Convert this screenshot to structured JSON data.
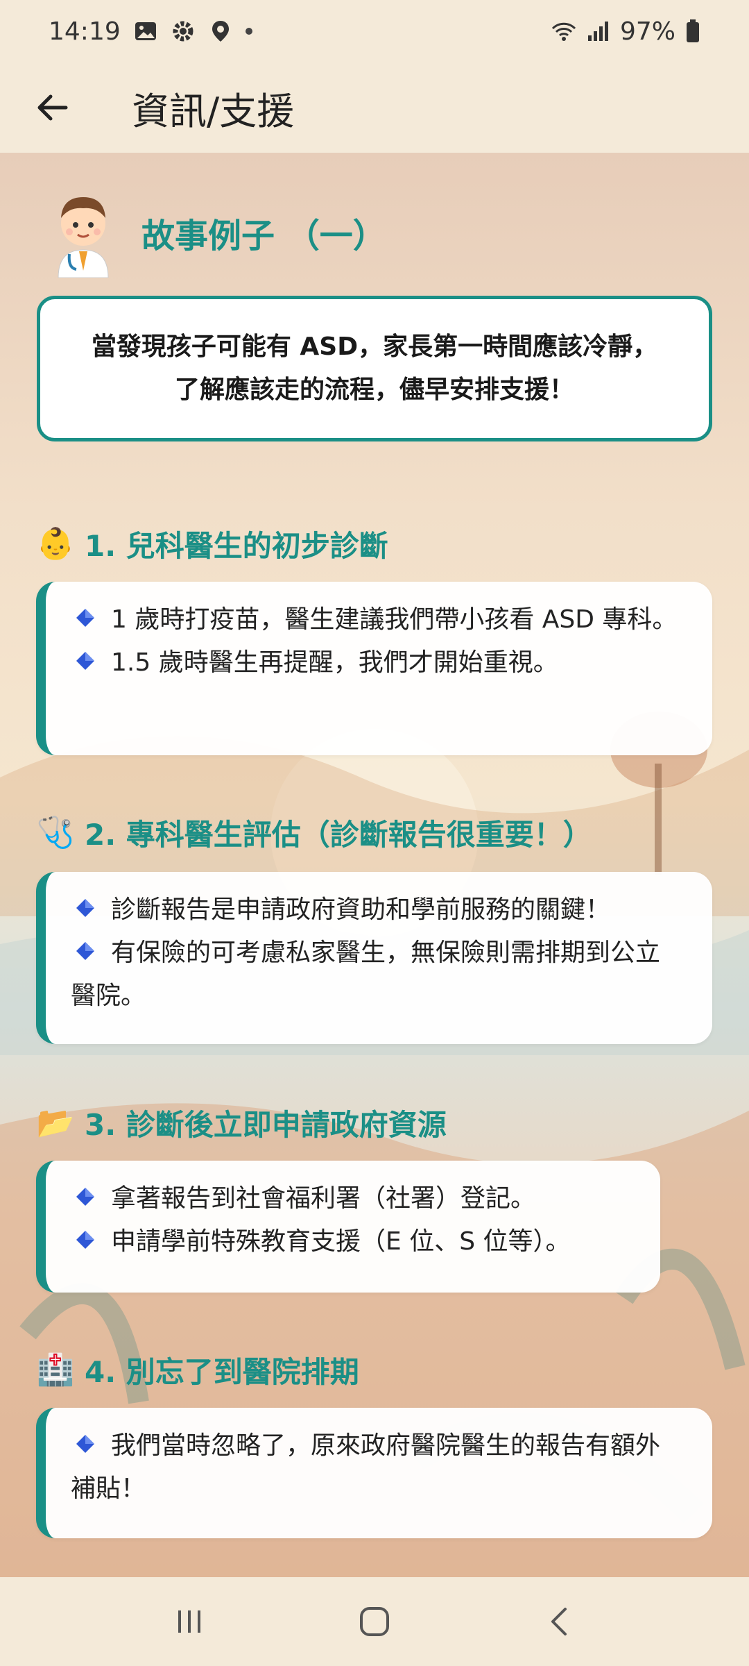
{
  "status_bar": {
    "time": "14:19",
    "battery": "97%",
    "icons_left": [
      "image-icon",
      "gear-icon",
      "location-icon",
      "dot-icon"
    ],
    "icons_right": [
      "wifi-icon",
      "signal-icon",
      "battery-icon"
    ]
  },
  "app_bar": {
    "title": "資訊/支援",
    "back_icon": "arrow-left-icon"
  },
  "story": {
    "title": "故事例子 （一）",
    "avatar": "doctor-avatar",
    "intro": "當發現孩子可能有 ASD，家長第一時間應該冷靜，了解應該走的流程，儘早安排支援！"
  },
  "sections": [
    {
      "emoji": "👶",
      "title": "1. 兒科醫生的初步診斷",
      "bullets": [
        "1 歲時打疫苗，醫生建議我們帶小孩看 ASD 專科。",
        "1.5 歲時醫生再提醒，我們才開始重視。"
      ]
    },
    {
      "emoji": "🩺",
      "title": "2. 專科醫生評估（診斷報告很重要！）",
      "bullets": [
        "診斷報告是申請政府資助和學前服務的關鍵！",
        "有保險的可考慮私家醫生，無保險則需排期到公立醫院。"
      ]
    },
    {
      "emoji": "📂",
      "title": "3. 診斷後立即申請政府資源",
      "bullets": [
        "拿著報告到社會福利署（社署）登記。",
        "申請學前特殊教育支援（E 位、S 位等）。"
      ]
    },
    {
      "emoji": "🏥",
      "title": "4. 別忘了到醫院排期",
      "bullets": [
        "我們當時忽略了，原來政府醫院醫生的報告有額外補貼！"
      ]
    }
  ],
  "colors": {
    "accent": "#1a8f86",
    "bullet": "#2e57d6",
    "app_bg": "#f4ead9"
  },
  "nav_bar": {
    "icons": [
      "recent-apps-icon",
      "home-icon",
      "back-icon"
    ]
  }
}
